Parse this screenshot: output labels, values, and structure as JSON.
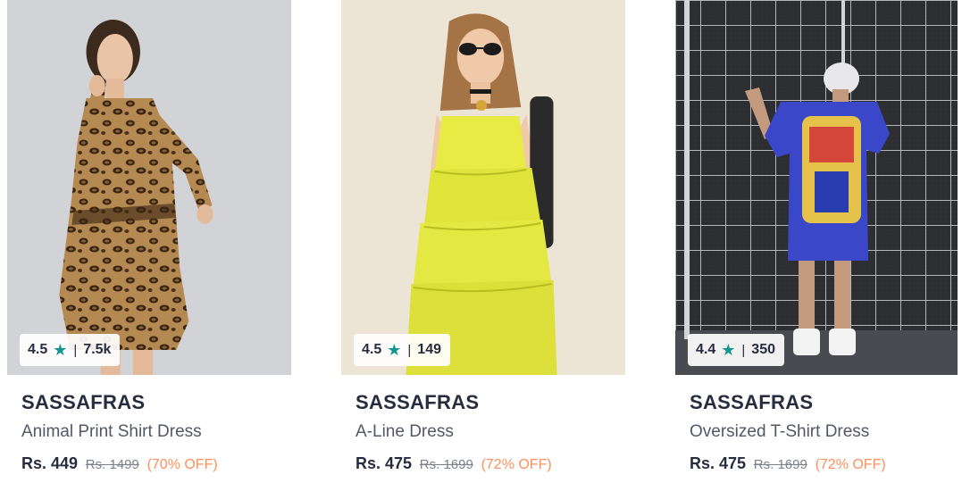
{
  "products": [
    {
      "image": "woman-leopard-print-shirt-dress",
      "rating": "4.5",
      "rating_count": "7.5k",
      "brand": "SASSAFRAS",
      "title": "Animal Print Shirt Dress",
      "price": "Rs. 449",
      "mrp": "Rs. 1499",
      "discount": "(70% OFF)"
    },
    {
      "image": "woman-yellow-tiered-a-line-dress",
      "rating": "4.5",
      "rating_count": "149",
      "brand": "SASSAFRAS",
      "title": "A-Line Dress",
      "price": "Rs. 475",
      "mrp": "Rs. 1699",
      "discount": "(72% OFF)"
    },
    {
      "image": "person-blue-oversized-tshirt-dress",
      "rating": "4.4",
      "rating_count": "350",
      "brand": "SASSAFRAS",
      "title": "Oversized T-Shirt Dress",
      "price": "Rs. 475",
      "mrp": "Rs. 1699",
      "discount": "(72% OFF)"
    }
  ],
  "icons": {
    "rating_star": "star-icon"
  },
  "colors": {
    "star": "#14958f",
    "brand_text": "#282c3f",
    "title_text": "#535766",
    "mrp_text": "#7e818c",
    "discount_text": "#ff905a"
  }
}
